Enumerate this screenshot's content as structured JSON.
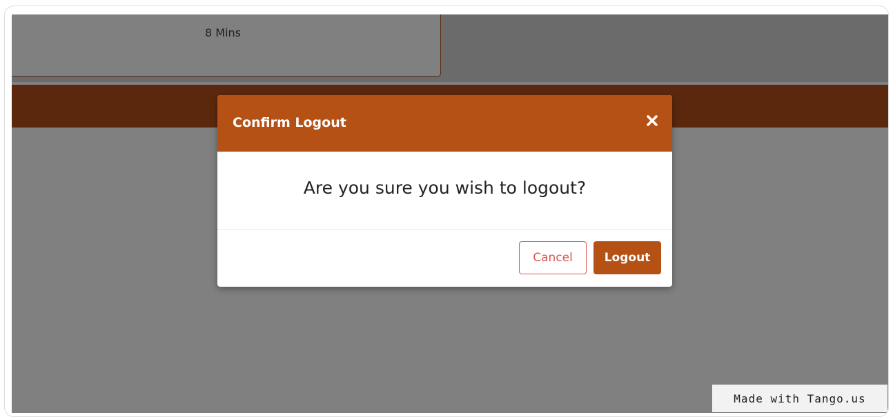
{
  "background": {
    "card_text": "8 Mins"
  },
  "dialog": {
    "title": "Confirm Logout",
    "close_icon": "close-icon",
    "message": "Are you sure you wish to logout?",
    "buttons": {
      "cancel_label": "Cancel",
      "logout_label": "Logout"
    }
  },
  "watermark": {
    "text": "Made with Tango.us"
  },
  "colors": {
    "modal_header": "#b55114",
    "header_bar": "#5c280d",
    "overlay": "#808080",
    "cancel_border": "#d9534f"
  }
}
